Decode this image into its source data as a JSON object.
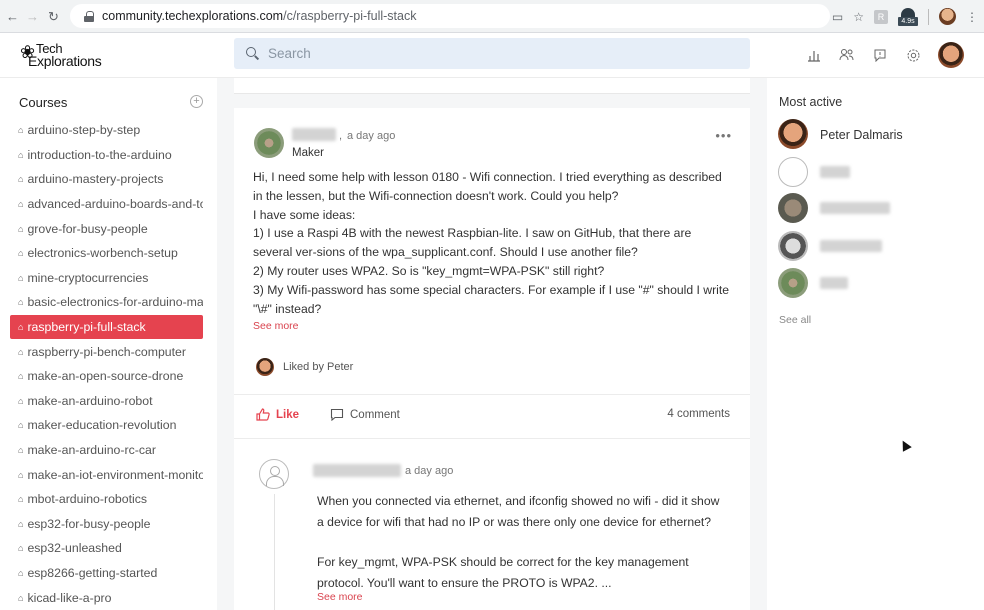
{
  "browser": {
    "url_host": "community.techexplorations.com",
    "url_path": "/c/raspberry-pi-full-stack",
    "ext_badge": "4.9s",
    "ext_letter": "R"
  },
  "header": {
    "logo_line1": "Tech",
    "logo_line2": "Explorations",
    "search_placeholder": "Search"
  },
  "sidebar": {
    "heading": "Courses",
    "add_label": "+",
    "courses": [
      "arduino-step-by-step",
      "introduction-to-the-arduino",
      "arduino-mastery-projects",
      "advanced-arduino-boards-and-to",
      "grove-for-busy-people",
      "electronics-worbench-setup",
      "mine-cryptocurrencies",
      "basic-electronics-for-arduino-mal",
      "raspberry-pi-full-stack",
      "raspberry-pi-bench-computer",
      "make-an-open-source-drone",
      "make-an-arduino-robot",
      "maker-education-revolution",
      "make-an-arduino-rc-car",
      "make-an-iot-environment-monitoi",
      "mbot-arduino-robotics",
      "esp32-for-busy-people",
      "esp32-unleashed",
      "esp8266-getting-started",
      "kicad-like-a-pro"
    ],
    "active_index": 8
  },
  "post": {
    "separator": ",",
    "time": "a day ago",
    "role": "Maker",
    "more": "•••",
    "body": [
      "Hi, I need some help with lesson 0180 - Wifi connection. I tried everything as described in the lessen, but the Wifi-connection doesn't work. Could you help?",
      "I have some ideas:",
      "1) I use a Raspi 4B with the newest Raspbian-lite. I saw on GitHub, that there are several ver-sions of the wpa_supplicant.conf. Should I use another file?",
      "2) My router uses WPA2. So is \"key_mgmt=WPA-PSK\" still right?",
      "3) My Wifi-password has some special characters. For example if I use \"#\" should I write \"\\#\" instead?"
    ],
    "see_more": "See more",
    "liked_by": "Liked by Peter",
    "like_label": "Like",
    "comment_label": "Comment",
    "comments_count": "4 comments"
  },
  "reply": {
    "time": "a day ago",
    "paragraph1": "When you connected via ethernet, and ifconfig showed no wifi - did it show a device for wifi that had no IP or was there only one device for ethernet?",
    "paragraph2": "For key_mgmt, WPA-PSK should be correct for the key management protocol. You'll want to ensure the PROTO is WPA2. ...",
    "see_more": "See more"
  },
  "right_panel": {
    "title": "Most active",
    "top_member": "Peter Dalmaris",
    "see_all": "See all"
  },
  "colors": {
    "accent": "#e5434f",
    "search_bg": "#e6eef8",
    "feed_bg": "#f5f6f7"
  }
}
